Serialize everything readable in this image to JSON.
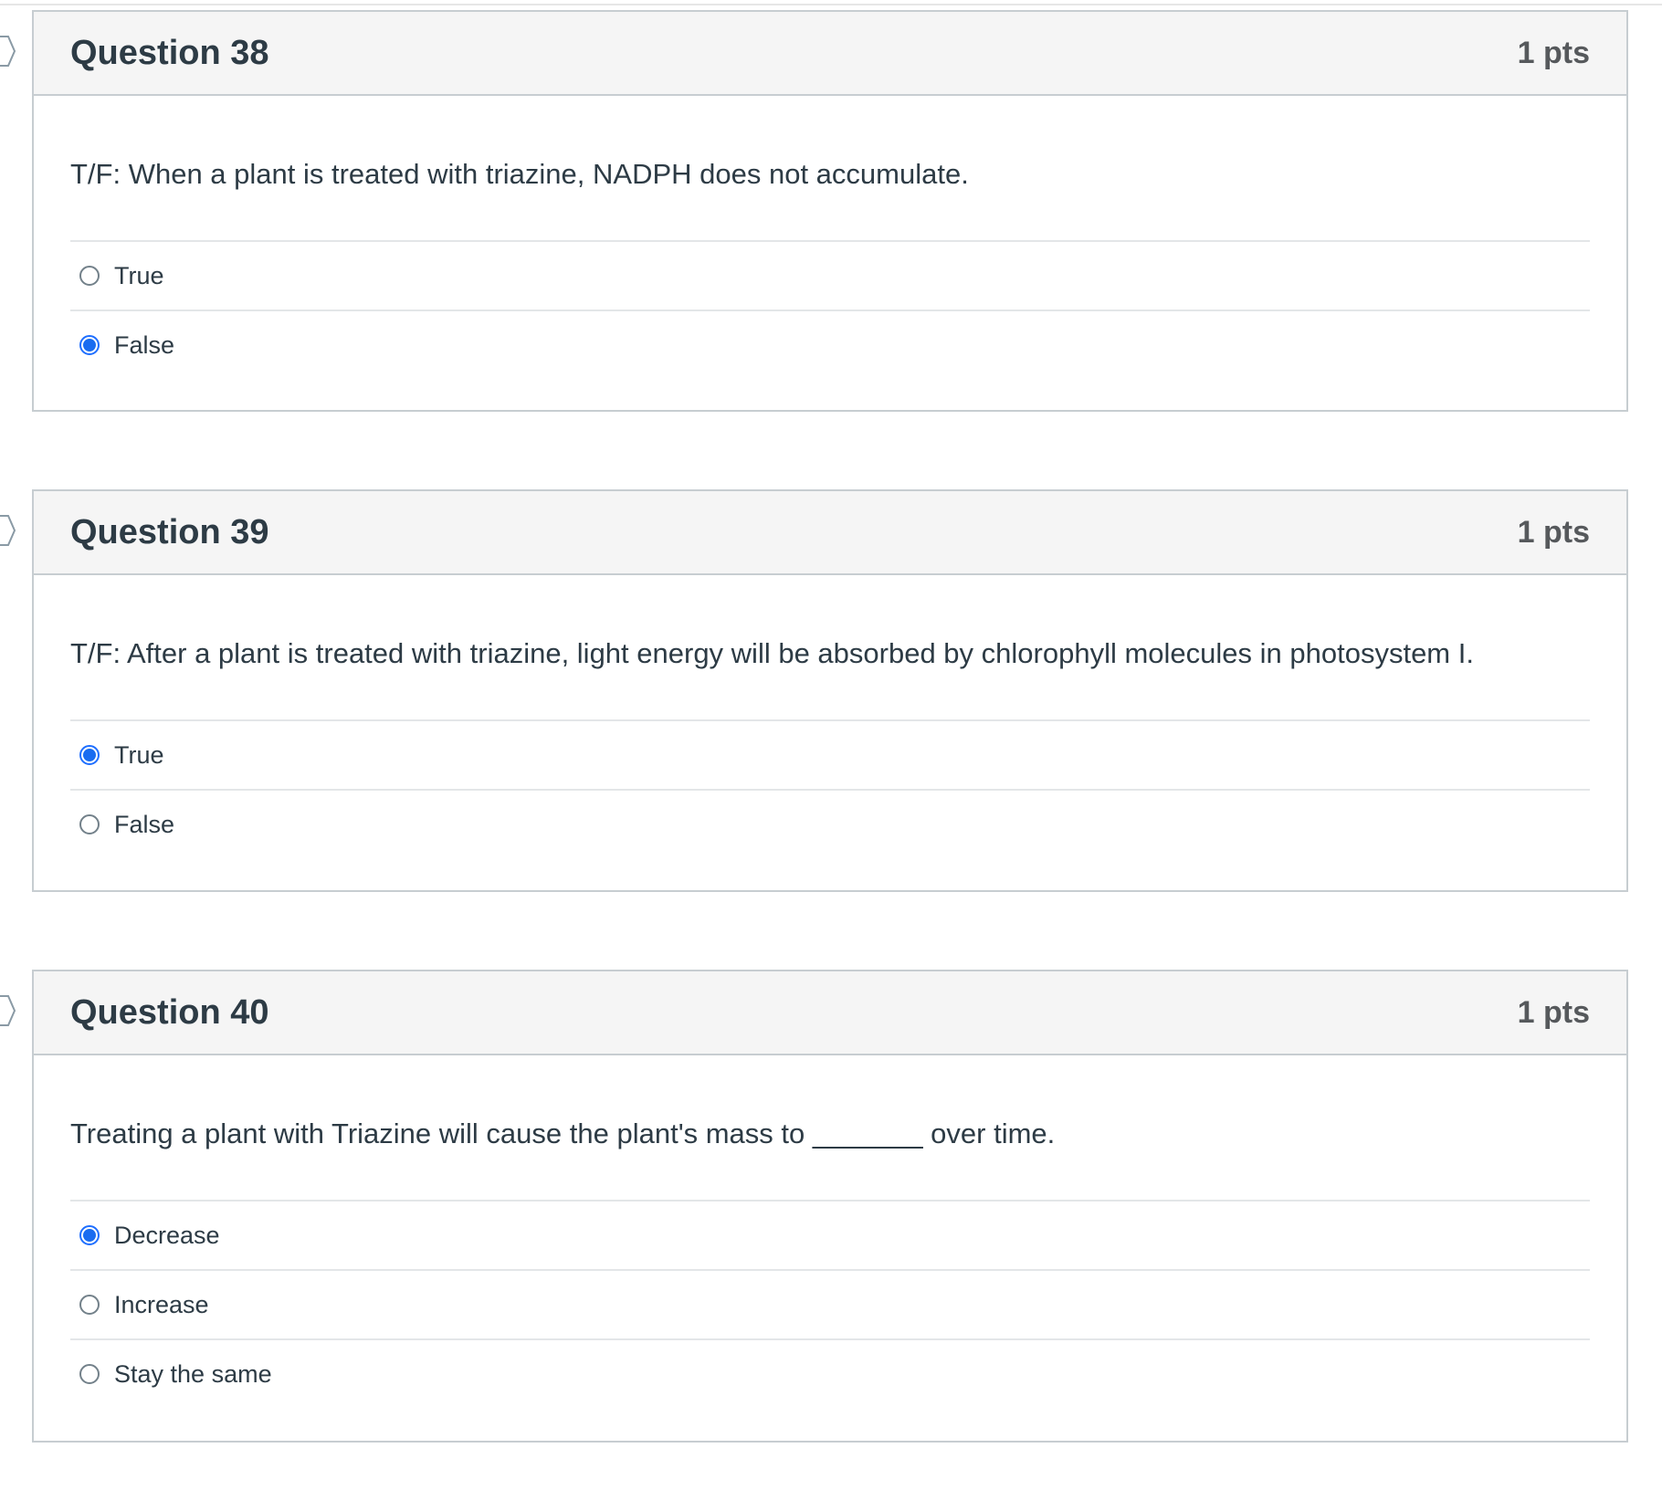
{
  "questions": [
    {
      "title": "Question 38",
      "points": "1 pts",
      "text": "T/F: When a plant is treated with triazine, NADPH does not accumulate.",
      "answers": [
        {
          "label": "True",
          "selected": false
        },
        {
          "label": "False",
          "selected": true
        }
      ]
    },
    {
      "title": "Question 39",
      "points": "1 pts",
      "text": "T/F: After a plant is treated with triazine, light energy will be absorbed by chlorophyll molecules in photosystem I.",
      "answers": [
        {
          "label": "True",
          "selected": true
        },
        {
          "label": "False",
          "selected": false
        }
      ]
    },
    {
      "title": "Question 40",
      "points": "1 pts",
      "text": "Treating a plant with Triazine will cause the plant's mass to _______ over time.",
      "answers": [
        {
          "label": "Decrease",
          "selected": true
        },
        {
          "label": "Increase",
          "selected": false
        },
        {
          "label": "Stay the same",
          "selected": false
        }
      ]
    }
  ],
  "colors": {
    "accent": "#1a6cf0",
    "header_bg": "#f5f5f5",
    "border": "#c7cdd1",
    "divider": "#e3e6e8"
  },
  "icons": {
    "side_marker": "flag-marker-icon"
  }
}
